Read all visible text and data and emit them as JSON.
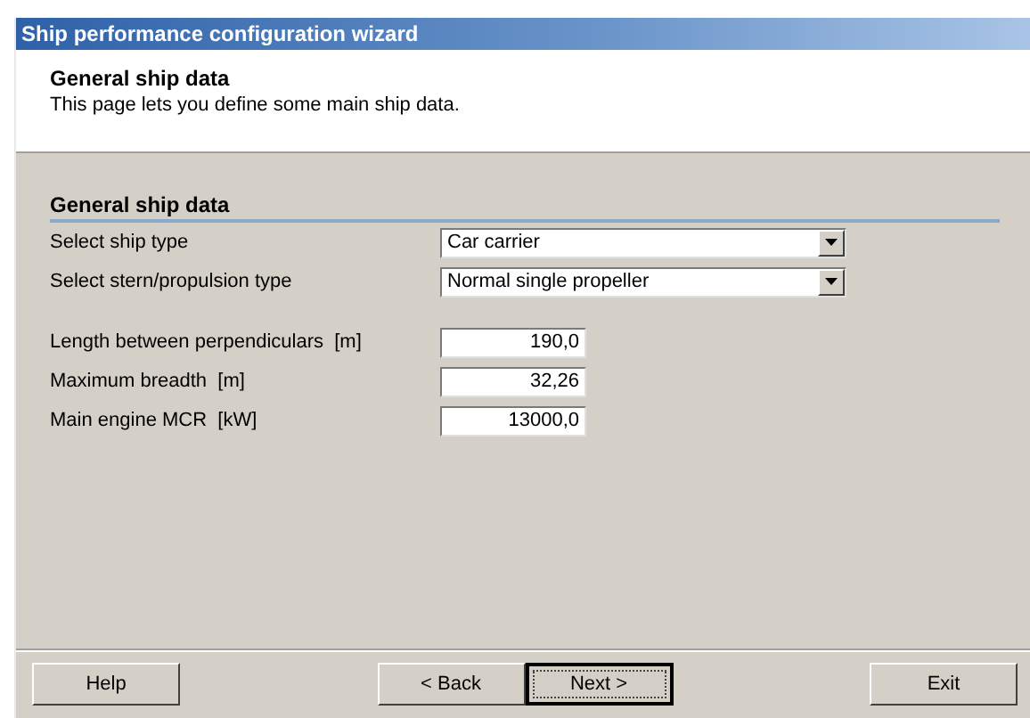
{
  "window": {
    "title": "Ship performance configuration wizard"
  },
  "header": {
    "title": "General ship data",
    "subtitle": "This page lets you define some main ship data."
  },
  "section": {
    "title": "General ship data"
  },
  "dropdowns": [
    {
      "label": "Select ship type",
      "value": "Car carrier"
    },
    {
      "label": "Select stern/propulsion type",
      "value": "Normal single propeller"
    }
  ],
  "fields": [
    {
      "label": "Length between perpendiculars  [m]",
      "value": "190,0"
    },
    {
      "label": "Maximum breadth  [m]",
      "value": "32,26"
    },
    {
      "label": "Main engine MCR  [kW]",
      "value": "13000,0"
    }
  ],
  "footer": {
    "left": [
      {
        "label": "Help",
        "default": false
      }
    ],
    "middle": [
      {
        "label": "< Back",
        "default": false
      },
      {
        "label": "Next >",
        "default": true
      }
    ],
    "right": [
      {
        "label": "Exit",
        "default": false
      }
    ]
  }
}
